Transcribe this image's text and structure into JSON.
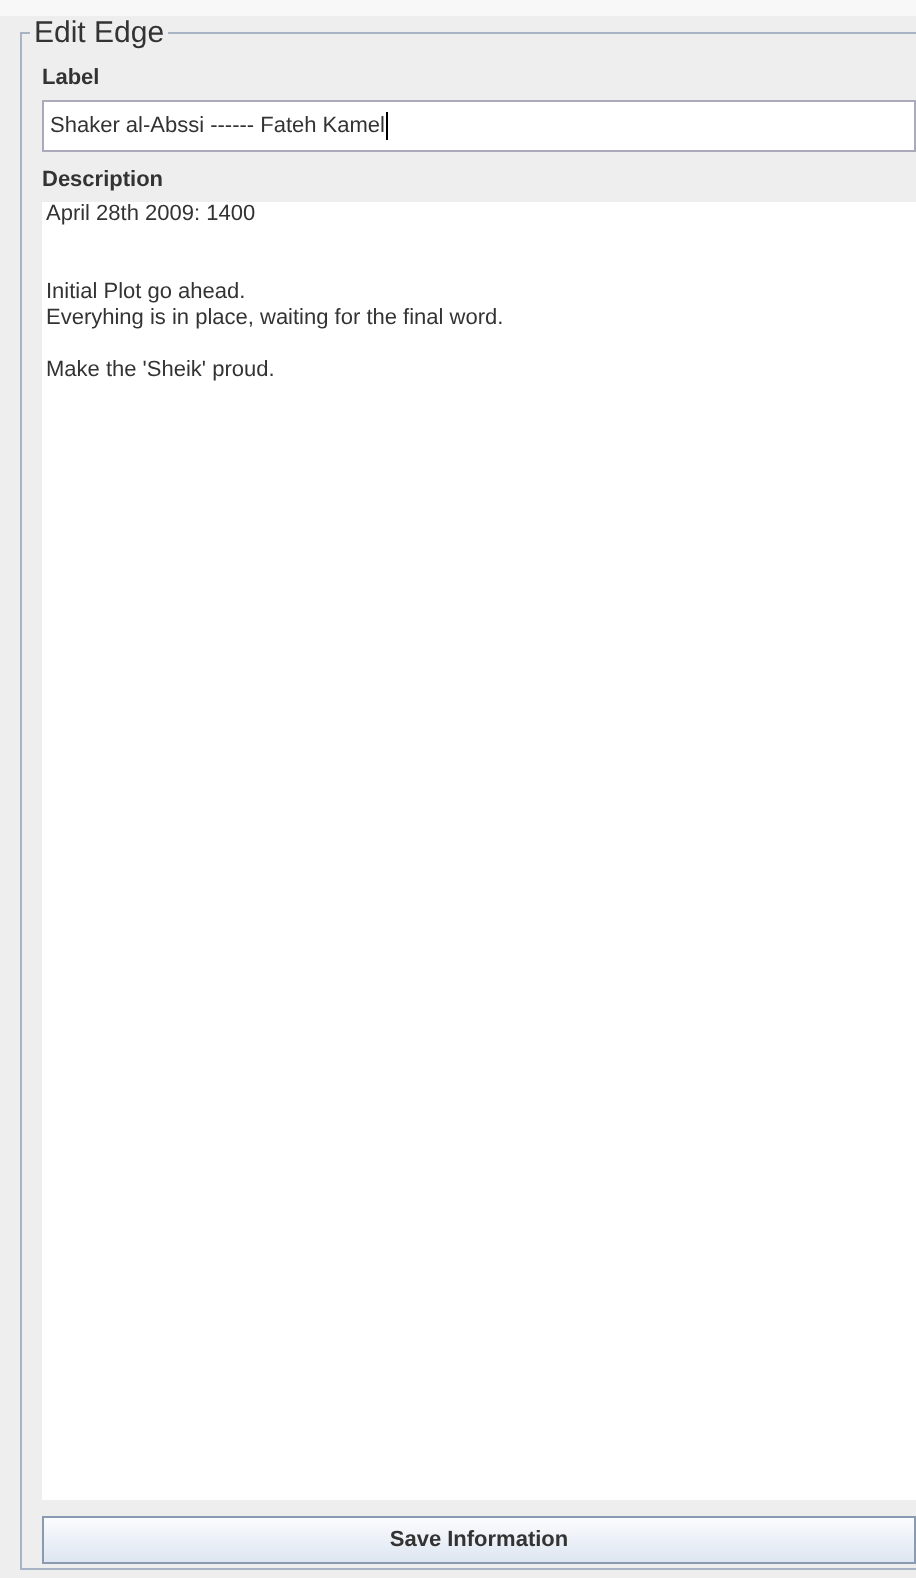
{
  "panel": {
    "title": "Edit Edge"
  },
  "label": {
    "caption": "Label",
    "value": "Shaker al-Abssi ------ Fateh Kamel",
    "focused": true
  },
  "description": {
    "caption": "Description",
    "value": "April 28th 2009: 1400\n\n\nInitial Plot go ahead.\nEveryhing is in place, waiting for the final word.\n\nMake the 'Sheik' proud."
  },
  "buttons": [
    {
      "label": "Save Information"
    }
  ]
}
